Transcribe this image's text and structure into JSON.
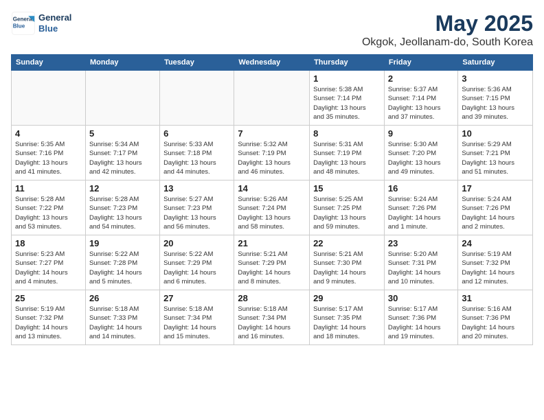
{
  "logo": {
    "line1": "General",
    "line2": "Blue"
  },
  "title": "May 2025",
  "subtitle": "Okgok, Jeollanam-do, South Korea",
  "weekdays": [
    "Sunday",
    "Monday",
    "Tuesday",
    "Wednesday",
    "Thursday",
    "Friday",
    "Saturday"
  ],
  "weeks": [
    [
      {
        "day": "",
        "info": ""
      },
      {
        "day": "",
        "info": ""
      },
      {
        "day": "",
        "info": ""
      },
      {
        "day": "",
        "info": ""
      },
      {
        "day": "1",
        "info": "Sunrise: 5:38 AM\nSunset: 7:14 PM\nDaylight: 13 hours\nand 35 minutes."
      },
      {
        "day": "2",
        "info": "Sunrise: 5:37 AM\nSunset: 7:14 PM\nDaylight: 13 hours\nand 37 minutes."
      },
      {
        "day": "3",
        "info": "Sunrise: 5:36 AM\nSunset: 7:15 PM\nDaylight: 13 hours\nand 39 minutes."
      }
    ],
    [
      {
        "day": "4",
        "info": "Sunrise: 5:35 AM\nSunset: 7:16 PM\nDaylight: 13 hours\nand 41 minutes."
      },
      {
        "day": "5",
        "info": "Sunrise: 5:34 AM\nSunset: 7:17 PM\nDaylight: 13 hours\nand 42 minutes."
      },
      {
        "day": "6",
        "info": "Sunrise: 5:33 AM\nSunset: 7:18 PM\nDaylight: 13 hours\nand 44 minutes."
      },
      {
        "day": "7",
        "info": "Sunrise: 5:32 AM\nSunset: 7:19 PM\nDaylight: 13 hours\nand 46 minutes."
      },
      {
        "day": "8",
        "info": "Sunrise: 5:31 AM\nSunset: 7:19 PM\nDaylight: 13 hours\nand 48 minutes."
      },
      {
        "day": "9",
        "info": "Sunrise: 5:30 AM\nSunset: 7:20 PM\nDaylight: 13 hours\nand 49 minutes."
      },
      {
        "day": "10",
        "info": "Sunrise: 5:29 AM\nSunset: 7:21 PM\nDaylight: 13 hours\nand 51 minutes."
      }
    ],
    [
      {
        "day": "11",
        "info": "Sunrise: 5:28 AM\nSunset: 7:22 PM\nDaylight: 13 hours\nand 53 minutes."
      },
      {
        "day": "12",
        "info": "Sunrise: 5:28 AM\nSunset: 7:23 PM\nDaylight: 13 hours\nand 54 minutes."
      },
      {
        "day": "13",
        "info": "Sunrise: 5:27 AM\nSunset: 7:23 PM\nDaylight: 13 hours\nand 56 minutes."
      },
      {
        "day": "14",
        "info": "Sunrise: 5:26 AM\nSunset: 7:24 PM\nDaylight: 13 hours\nand 58 minutes."
      },
      {
        "day": "15",
        "info": "Sunrise: 5:25 AM\nSunset: 7:25 PM\nDaylight: 13 hours\nand 59 minutes."
      },
      {
        "day": "16",
        "info": "Sunrise: 5:24 AM\nSunset: 7:26 PM\nDaylight: 14 hours\nand 1 minute."
      },
      {
        "day": "17",
        "info": "Sunrise: 5:24 AM\nSunset: 7:26 PM\nDaylight: 14 hours\nand 2 minutes."
      }
    ],
    [
      {
        "day": "18",
        "info": "Sunrise: 5:23 AM\nSunset: 7:27 PM\nDaylight: 14 hours\nand 4 minutes."
      },
      {
        "day": "19",
        "info": "Sunrise: 5:22 AM\nSunset: 7:28 PM\nDaylight: 14 hours\nand 5 minutes."
      },
      {
        "day": "20",
        "info": "Sunrise: 5:22 AM\nSunset: 7:29 PM\nDaylight: 14 hours\nand 6 minutes."
      },
      {
        "day": "21",
        "info": "Sunrise: 5:21 AM\nSunset: 7:29 PM\nDaylight: 14 hours\nand 8 minutes."
      },
      {
        "day": "22",
        "info": "Sunrise: 5:21 AM\nSunset: 7:30 PM\nDaylight: 14 hours\nand 9 minutes."
      },
      {
        "day": "23",
        "info": "Sunrise: 5:20 AM\nSunset: 7:31 PM\nDaylight: 14 hours\nand 10 minutes."
      },
      {
        "day": "24",
        "info": "Sunrise: 5:19 AM\nSunset: 7:32 PM\nDaylight: 14 hours\nand 12 minutes."
      }
    ],
    [
      {
        "day": "25",
        "info": "Sunrise: 5:19 AM\nSunset: 7:32 PM\nDaylight: 14 hours\nand 13 minutes."
      },
      {
        "day": "26",
        "info": "Sunrise: 5:18 AM\nSunset: 7:33 PM\nDaylight: 14 hours\nand 14 minutes."
      },
      {
        "day": "27",
        "info": "Sunrise: 5:18 AM\nSunset: 7:34 PM\nDaylight: 14 hours\nand 15 minutes."
      },
      {
        "day": "28",
        "info": "Sunrise: 5:18 AM\nSunset: 7:34 PM\nDaylight: 14 hours\nand 16 minutes."
      },
      {
        "day": "29",
        "info": "Sunrise: 5:17 AM\nSunset: 7:35 PM\nDaylight: 14 hours\nand 18 minutes."
      },
      {
        "day": "30",
        "info": "Sunrise: 5:17 AM\nSunset: 7:36 PM\nDaylight: 14 hours\nand 19 minutes."
      },
      {
        "day": "31",
        "info": "Sunrise: 5:16 AM\nSunset: 7:36 PM\nDaylight: 14 hours\nand 20 minutes."
      }
    ]
  ]
}
